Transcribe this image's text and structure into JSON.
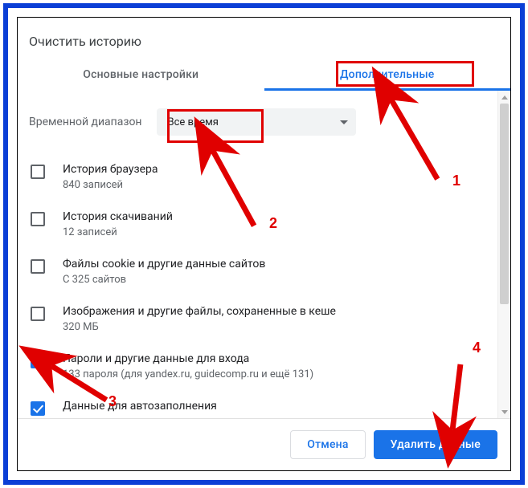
{
  "dialog": {
    "title": "Очистить историю"
  },
  "tabs": {
    "basic": "Основные настройки",
    "advanced": "Дополнительные"
  },
  "range": {
    "label": "Временной диапазон",
    "selected": "Все время"
  },
  "items": [
    {
      "checked": false,
      "label": "История браузера",
      "sub": "840 записей"
    },
    {
      "checked": false,
      "label": "История скачиваний",
      "sub": "12 записей"
    },
    {
      "checked": false,
      "label": "Файлы cookie и другие данные сайтов",
      "sub": "С 325 сайтов"
    },
    {
      "checked": false,
      "label": "Изображения и другие файлы, сохраненные в кеше",
      "sub": "320 МБ"
    },
    {
      "checked": true,
      "label": "Пароли и другие данные для входа",
      "sub": "133 пароля (для yandex.ru, guidecomp.ru и ещё 131)"
    },
    {
      "checked": true,
      "label": "Данные для автозаполнения",
      "sub": ""
    }
  ],
  "footer": {
    "cancel": "Отмена",
    "confirm": "Удалить данные"
  },
  "annotations": {
    "n1": "1",
    "n2": "2",
    "n3": "3",
    "n4": "4"
  }
}
